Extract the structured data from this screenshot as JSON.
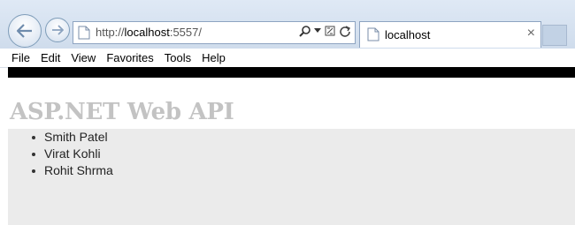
{
  "browser": {
    "url_prefix": "http://",
    "url_host": "localhost",
    "url_suffix": ":5557/",
    "tab_title": "localhost",
    "tab_close": "×"
  },
  "menu": [
    "File",
    "Edit",
    "View",
    "Favorites",
    "Tools",
    "Help"
  ],
  "page": {
    "heading": "ASP.NET Web API",
    "items": [
      "Smith Patel",
      "Virat Kohli",
      "Rohit Shrma"
    ]
  },
  "colors": {
    "heading": "#c3c3c3",
    "content_bg": "#ebebeb",
    "top_bar": "#000000"
  }
}
